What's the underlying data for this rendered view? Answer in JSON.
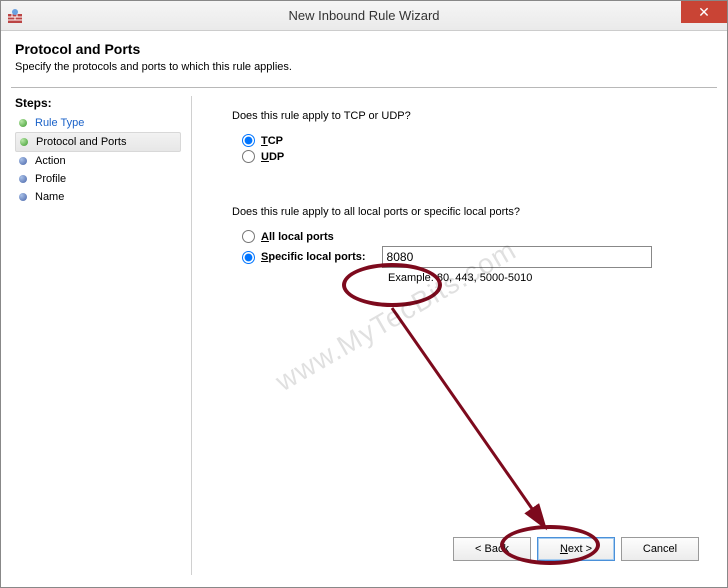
{
  "window": {
    "title": "New Inbound Rule Wizard",
    "close_glyph": "✕"
  },
  "header": {
    "title": "Protocol and Ports",
    "subtitle": "Specify the protocols and ports to which this rule applies."
  },
  "sidebar": {
    "label": "Steps:",
    "items": [
      {
        "label": "Rule Type"
      },
      {
        "label": "Protocol and Ports"
      },
      {
        "label": "Action"
      },
      {
        "label": "Profile"
      },
      {
        "label": "Name"
      }
    ]
  },
  "main": {
    "q_protocol": "Does this rule apply to TCP or UDP?",
    "tcp_prefix": "T",
    "tcp_rest": "CP",
    "udp_prefix": "U",
    "udp_rest": "DP",
    "q_ports": "Does this rule apply to all local ports or specific local ports?",
    "all_prefix": "A",
    "all_rest": "ll local ports",
    "spec_prefix": "S",
    "spec_rest": "pecific local ports:",
    "port_value": "8080",
    "example": "Example: 80, 443, 5000-5010"
  },
  "buttons": {
    "back": "< Back",
    "next_prefix": "N",
    "next_rest": "ext >",
    "cancel": "Cancel"
  },
  "watermark": "www.MyTecBits.com"
}
